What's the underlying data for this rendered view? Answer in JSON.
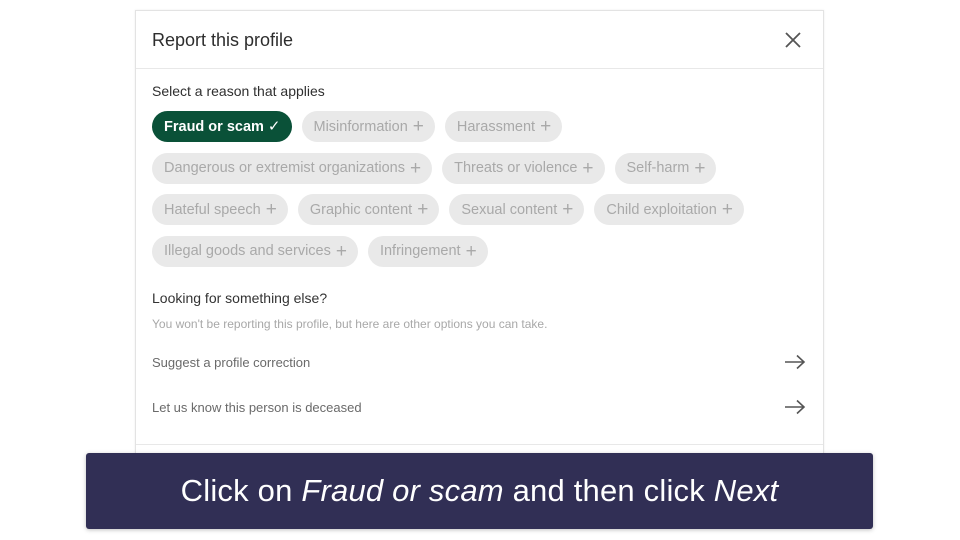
{
  "dialog": {
    "title": "Report this profile",
    "close_icon": "close-icon",
    "section_label": "Select a reason that applies",
    "reasons": [
      {
        "label": "Fraud or scam",
        "selected": true,
        "icon": "check-icon"
      },
      {
        "label": "Misinformation",
        "selected": false,
        "icon": "plus-icon"
      },
      {
        "label": "Harassment",
        "selected": false,
        "icon": "plus-icon"
      },
      {
        "label": "Dangerous or extremist organizations",
        "selected": false,
        "icon": "plus-icon"
      },
      {
        "label": "Threats or violence",
        "selected": false,
        "icon": "plus-icon"
      },
      {
        "label": "Self-harm",
        "selected": false,
        "icon": "plus-icon"
      },
      {
        "label": "Hateful speech",
        "selected": false,
        "icon": "plus-icon"
      },
      {
        "label": "Graphic content",
        "selected": false,
        "icon": "plus-icon"
      },
      {
        "label": "Sexual content",
        "selected": false,
        "icon": "plus-icon"
      },
      {
        "label": "Child exploitation",
        "selected": false,
        "icon": "plus-icon"
      },
      {
        "label": "Illegal goods and services",
        "selected": false,
        "icon": "plus-icon"
      },
      {
        "label": "Infringement",
        "selected": false,
        "icon": "plus-icon"
      }
    ],
    "icons": {
      "check": "✓",
      "plus": "+"
    },
    "other": {
      "title": "Looking for something else?",
      "subtitle": "You won't be reporting this profile, but here are other options you can take.",
      "options": [
        {
          "label": "Suggest a profile correction",
          "icon": "arrow-right-icon"
        },
        {
          "label": "Let us know this person is deceased",
          "icon": "arrow-right-icon"
        }
      ]
    }
  },
  "caption": {
    "part1": "Click on ",
    "emphasis1": "Fraud or scam",
    "part2": " and then click ",
    "emphasis2": "Next"
  },
  "colors": {
    "selected_pill": "#0a5138",
    "unselected_pill": "#e9e9e9",
    "caption_background": "#312f55"
  }
}
